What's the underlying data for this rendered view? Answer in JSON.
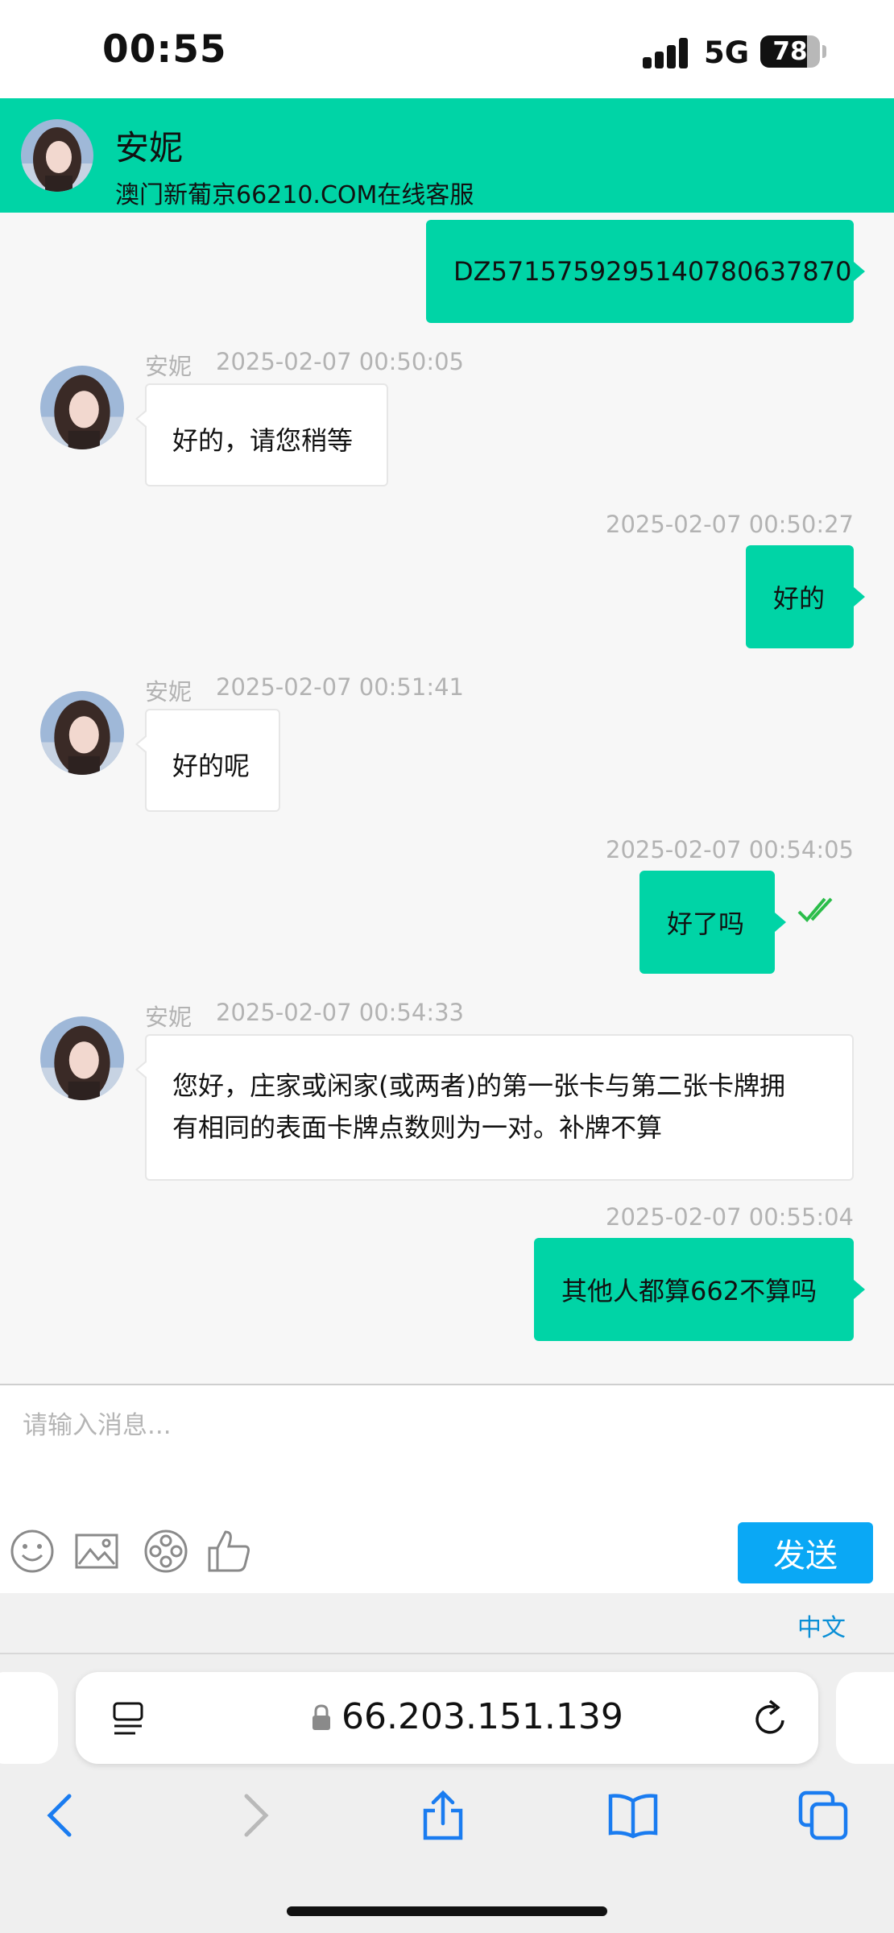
{
  "status_bar": {
    "time": "00:55",
    "network": "5G",
    "battery_percent": "78",
    "battery_level": 0.78
  },
  "header": {
    "agent_name": "安妮",
    "subtitle": "澳门新葡京66210.COM在线客服"
  },
  "messages": [
    {
      "id": 1,
      "from": "user",
      "text": "DZ5715759295140780637870",
      "time": ""
    },
    {
      "id": 2,
      "from": "agent",
      "sender": "安妮",
      "time": "2025-02-07 00:50:05",
      "text": "好的，请您稍等"
    },
    {
      "id": 3,
      "from": "user",
      "time": "2025-02-07 00:50:27",
      "text": "好的"
    },
    {
      "id": 4,
      "from": "agent",
      "sender": "安妮",
      "time": "2025-02-07 00:51:41",
      "text": "好的呢"
    },
    {
      "id": 5,
      "from": "user",
      "time": "2025-02-07 00:54:05",
      "text": "好了吗",
      "read_icon": "double-check-icon"
    },
    {
      "id": 6,
      "from": "agent",
      "sender": "安妮",
      "time": "2025-02-07 00:54:33",
      "text_line1": "您好，庄家或闲家(或两者)的第一张卡与第二张卡牌拥",
      "text_line2": "有相同的表面卡牌点数则为一对。补牌不算"
    },
    {
      "id": 7,
      "from": "user",
      "time": "2025-02-07 00:55:04",
      "text": "其他人都算662不算吗"
    }
  ],
  "composer": {
    "placeholder": "请输入消息...",
    "value": "",
    "tools": [
      "emoji-icon",
      "image-icon",
      "video-reel-icon",
      "thumbs-up-icon"
    ],
    "send_label": "发送"
  },
  "language": {
    "label": "中文"
  },
  "browser": {
    "url": "66.203.151.139",
    "icons": [
      "reader-icon",
      "lock-icon",
      "reload-icon",
      "back-icon",
      "forward-icon",
      "share-icon",
      "bookmarks-icon",
      "tabs-icon"
    ]
  },
  "colors": {
    "brand": "#00d4a6",
    "send_button": "#0aa8f5",
    "read_check": "#2bbd4a",
    "language_link": "#0a8fd6"
  }
}
